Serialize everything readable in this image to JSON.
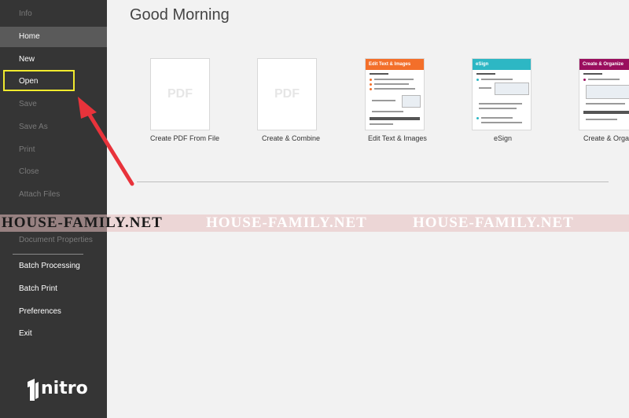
{
  "sidebar": {
    "items": [
      {
        "label": "Info",
        "state": "disabled"
      },
      {
        "label": "Home",
        "state": "selected"
      },
      {
        "label": "New",
        "state": "normal"
      },
      {
        "label": "Open",
        "state": "normal"
      },
      {
        "label": "Save",
        "state": "disabled"
      },
      {
        "label": "Save As",
        "state": "disabled"
      },
      {
        "label": "Print",
        "state": "disabled"
      },
      {
        "label": "Close",
        "state": "disabled"
      },
      {
        "label": "Attach Files",
        "state": "disabled"
      },
      {
        "label": "Document Properties",
        "state": "disabled"
      },
      {
        "label": "Batch Processing",
        "state": "normal"
      },
      {
        "label": "Batch Print",
        "state": "normal"
      },
      {
        "label": "Preferences",
        "state": "normal"
      },
      {
        "label": "Exit",
        "state": "normal"
      }
    ],
    "logo_text": "nitro"
  },
  "main": {
    "greeting": "Good Morning",
    "tiles": [
      {
        "caption": "Create PDF From File",
        "thumb_text": "PDF"
      },
      {
        "caption": "Create & Combine",
        "thumb_text": "PDF"
      },
      {
        "caption": "Edit Text & Images",
        "header": "Edit Text & Images",
        "header_color": "#f36f2a"
      },
      {
        "caption": "eSign",
        "header": "eSign",
        "header_color": "#2db7c4"
      },
      {
        "caption": "Create & Organiz",
        "header": "Create & Organize",
        "header_color": "#9a0e5e"
      }
    ]
  },
  "watermark": {
    "text_1": "HOUSE-FAMILY.NET",
    "text_2": "HOUSE-FAMILY.NET",
    "text_3": "HOUSE-FAMILY.NET"
  },
  "colors": {
    "sidebar_bg": "#353535",
    "highlight": "#f1ea2e",
    "arrow": "#e8333b"
  }
}
